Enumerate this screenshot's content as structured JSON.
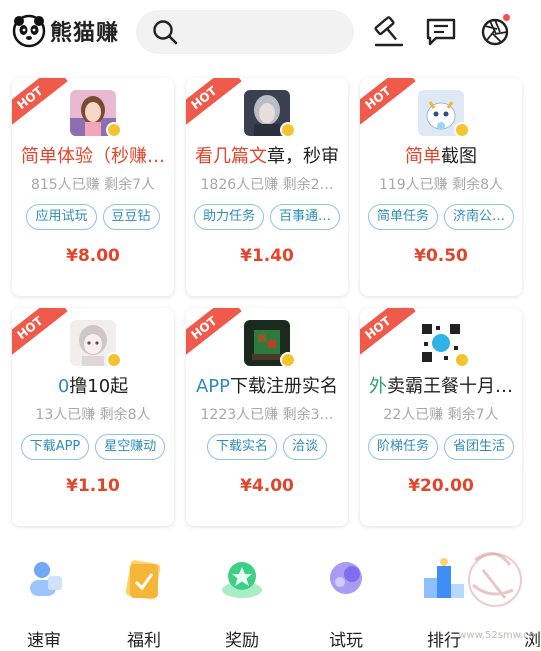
{
  "header": {
    "app_name": "熊猫赚",
    "icons": [
      "panda-logo",
      "search-icon",
      "hammer-icon",
      "message-icon",
      "aperture-icon"
    ]
  },
  "cards": [
    {
      "hot": "HOT",
      "title_colored": "简单体验",
      "title_rest": "（秒赚…",
      "stats": "815人已赚  剩余7人",
      "tags": [
        "应用试玩",
        "豆豆钻"
      ],
      "price": "¥8.00"
    },
    {
      "hot": "HOT",
      "title_colored": "看几篇文",
      "title_rest": "章，秒审",
      "stats": "1826人已赚  剩余2…",
      "tags": [
        "助力任务",
        "百事通…"
      ],
      "price": "¥1.40"
    },
    {
      "hot": "HOT",
      "title_colored": "简单",
      "title_rest": "截图",
      "stats": "119人已赚  剩余8人",
      "tags": [
        "简单任务",
        "济南公…"
      ],
      "price": "¥0.50"
    },
    {
      "hot": "HOT",
      "title_colored": "0",
      "title_rest": "撸10起",
      "stats": "13人已赚  剩余8人",
      "tags": [
        "下载APP",
        "星空赚动"
      ],
      "price": "¥1.10"
    },
    {
      "hot": "HOT",
      "title_colored": "APP",
      "title_rest": "下载注册实名",
      "stats": "1223人已赚  剩余3…",
      "tags": [
        "下载实名",
        "洽谈"
      ],
      "price": "¥4.00"
    },
    {
      "hot": "HOT",
      "title_colored": "外",
      "title_rest": "卖霸王餐十月…",
      "stats": "22人已赚  剩余7人",
      "tags": [
        "阶梯任务",
        "省团生活"
      ],
      "price": "¥20.00"
    }
  ],
  "nav": [
    {
      "label": "速审"
    },
    {
      "label": "福利"
    },
    {
      "label": "奖励"
    },
    {
      "label": "试玩"
    },
    {
      "label": "排行"
    },
    {
      "label": "浏"
    }
  ],
  "watermark": "www.52smw.cn",
  "colors": {
    "hot": "#f05a4a",
    "price": "#e2452b",
    "tag_border": "#8fc5de",
    "tag_text": "#2f8cb8",
    "title_red": "#e2452b",
    "title_green": "#2aa36b",
    "title_blue": "#2f8cb8"
  }
}
